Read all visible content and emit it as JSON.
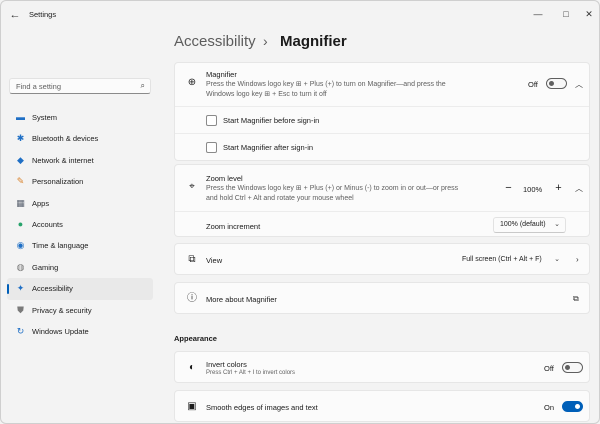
{
  "app": {
    "title": "Settings"
  },
  "window_controls": {
    "minimize": "—",
    "maximize": "□",
    "close": "✕"
  },
  "search": {
    "placeholder": "Find a setting"
  },
  "sidebar": {
    "items": [
      {
        "label": "System",
        "icon": "system-icon",
        "glyph": "▬",
        "color": "#1f6fc5"
      },
      {
        "label": "Bluetooth & devices",
        "icon": "bluetooth-icon",
        "glyph": "✱",
        "color": "#1f6fc5"
      },
      {
        "label": "Network & internet",
        "icon": "wifi-icon",
        "glyph": "◆",
        "color": "#1f6fc5"
      },
      {
        "label": "Personalization",
        "icon": "brush-icon",
        "glyph": "✎",
        "color": "#d9822b"
      },
      {
        "label": "Apps",
        "icon": "apps-icon",
        "glyph": "▦",
        "color": "#5a6270"
      },
      {
        "label": "Accounts",
        "icon": "accounts-icon",
        "glyph": "●",
        "color": "#27a36b"
      },
      {
        "label": "Time & language",
        "icon": "globe-icon",
        "glyph": "◉",
        "color": "#1f6fc5"
      },
      {
        "label": "Gaming",
        "icon": "gaming-icon",
        "glyph": "◍",
        "color": "#7a7a7a"
      },
      {
        "label": "Accessibility",
        "icon": "accessibility-icon",
        "glyph": "✦",
        "color": "#1f6fc5",
        "active": true
      },
      {
        "label": "Privacy & security",
        "icon": "shield-icon",
        "glyph": "⛊",
        "color": "#7a7a7a"
      },
      {
        "label": "Windows Update",
        "icon": "update-icon",
        "glyph": "↻",
        "color": "#1f6fc5"
      }
    ]
  },
  "breadcrumb": {
    "parent": "Accessibility",
    "separator": "›",
    "current": "Magnifier"
  },
  "magnifier": {
    "title": "Magnifier",
    "desc_line1": "Press the Windows logo key ⊞ + Plus (+) to turn on Magnifier—and press the",
    "desc_line2": "Windows logo key ⊞ + Esc to turn it off",
    "state": "Off",
    "checkbox1": "Start Magnifier before sign-in",
    "checkbox2": "Start Magnifier after sign-in"
  },
  "zoom": {
    "title": "Zoom level",
    "desc_line1": "Press the Windows logo key ⊞ + Plus (+) or Minus (-) to zoom in or out—or press",
    "desc_line2": "and hold Ctrl + Alt and rotate your mouse wheel",
    "value": "100%",
    "minus": "−",
    "plus": "+",
    "increment_label": "Zoom increment",
    "increment_value": "100% (default)"
  },
  "view": {
    "title": "View",
    "value": "Full screen (Ctrl + Alt + F)"
  },
  "more": {
    "title": "More about Magnifier"
  },
  "appearance": {
    "section_title": "Appearance",
    "invert": {
      "title": "Invert colors",
      "desc": "Press Ctrl + Alt + I to invert colors",
      "state": "Off"
    },
    "smooth": {
      "title": "Smooth edges of images and text",
      "state": "On"
    }
  },
  "colors": {
    "accent": "#005fb8"
  }
}
